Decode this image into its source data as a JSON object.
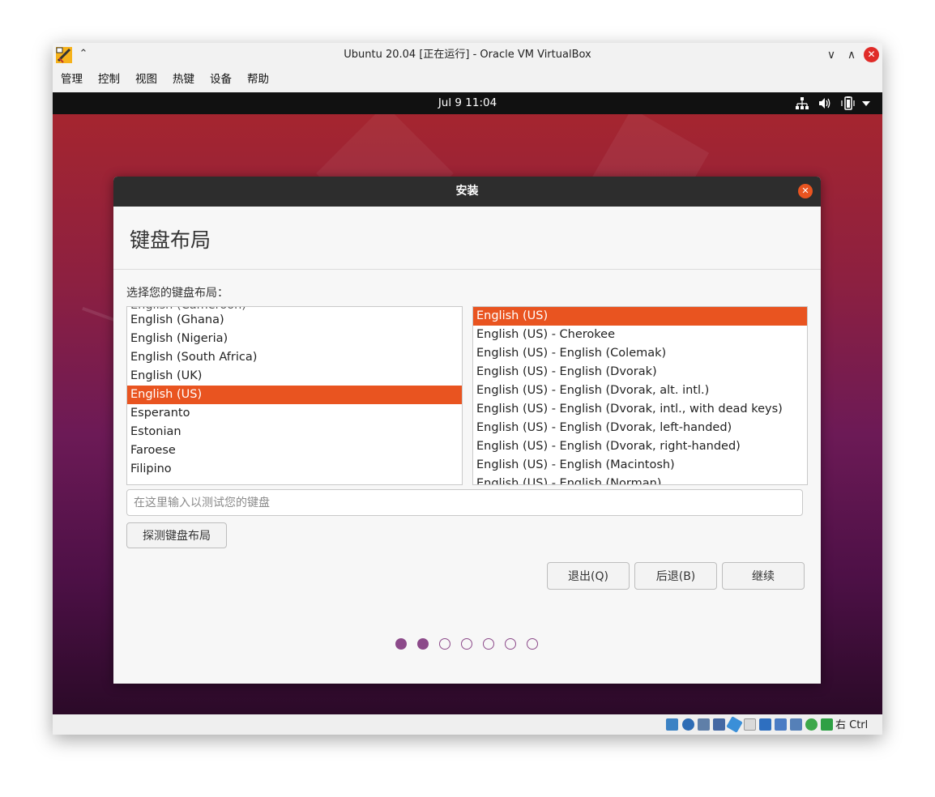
{
  "window": {
    "title": "Ubuntu 20.04 [正在运行] - Oracle VM VirtualBox",
    "minimize_icon": "∨",
    "maximize_icon": "∧",
    "close_icon": "✕"
  },
  "menu": [
    "管理",
    "控制",
    "视图",
    "热键",
    "设备",
    "帮助"
  ],
  "topbar": {
    "clock": "Jul 9  11:04"
  },
  "installer": {
    "title": "安装",
    "heading": "键盘布局",
    "prompt": "选择您的键盘布局：",
    "layouts": [
      "English (Ghana)",
      "English (Nigeria)",
      "English (South Africa)",
      "English (UK)",
      "English (US)",
      "Esperanto",
      "Estonian",
      "Faroese",
      "Filipino"
    ],
    "selected_layout": "English (US)",
    "variants": [
      "English (US)",
      "English (US) - Cherokee",
      "English (US) - English (Colemak)",
      "English (US) - English (Dvorak)",
      "English (US) - English (Dvorak, alt. intl.)",
      "English (US) - English (Dvorak, intl., with dead keys)",
      "English (US) - English (Dvorak, left-handed)",
      "English (US) - English (Dvorak, right-handed)",
      "English (US) - English (Macintosh)",
      "English (US) - English (Norman)"
    ],
    "selected_variant": "English (US)",
    "test_placeholder": "在这里输入以测试您的键盘",
    "detect_button": "探测键盘布局",
    "quit_button": "退出(Q)",
    "back_button": "后退(B)",
    "continue_button": "继续",
    "progress": {
      "current_step": 2,
      "total_steps": 7
    }
  },
  "statusbar": {
    "host_key": "右 Ctrl"
  },
  "colors": {
    "accent": "#e95420",
    "progress_dot": "#8c4a8a",
    "dialog_header": "#2d2d2d"
  }
}
